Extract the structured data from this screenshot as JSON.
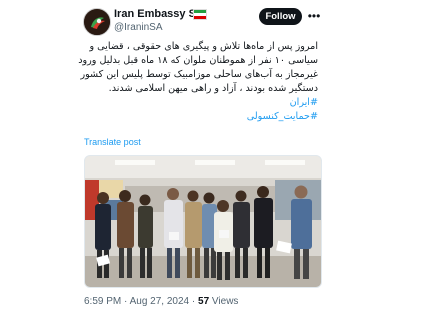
{
  "header": {
    "display_name": "Iran Embassy SA",
    "handle": "@IraninSA",
    "follow_label": "Follow",
    "more_label": "•••"
  },
  "flag_colors": [
    "#239f40",
    "#ffffff",
    "#da0000"
  ],
  "tweet": {
    "lines": [
      "امروز پس از ماه‌ها تلاش و پیگیری های حقوقی ، قضایی و",
      "سیاسی ۱۰ نفر از هموطنان ملوان که ۱۸ ماه قبل بدلیل ورود",
      "غیرمجاز به آب‌های ساحلی موزامبیک توسط پلیس این کشور",
      "دستگیر شده بودند ، آزاد و راهی میهن اسلامی شدند."
    ],
    "hashtags": [
      "#ایران",
      "#حمایت_کنسولی"
    ],
    "translate_label": "Translate post"
  },
  "photo": {
    "icon": "group-photo"
  },
  "meta": {
    "time": "6:59 PM",
    "separator": "·",
    "date": "Aug 27, 2024",
    "views_count": "57",
    "views_label": "Views"
  }
}
